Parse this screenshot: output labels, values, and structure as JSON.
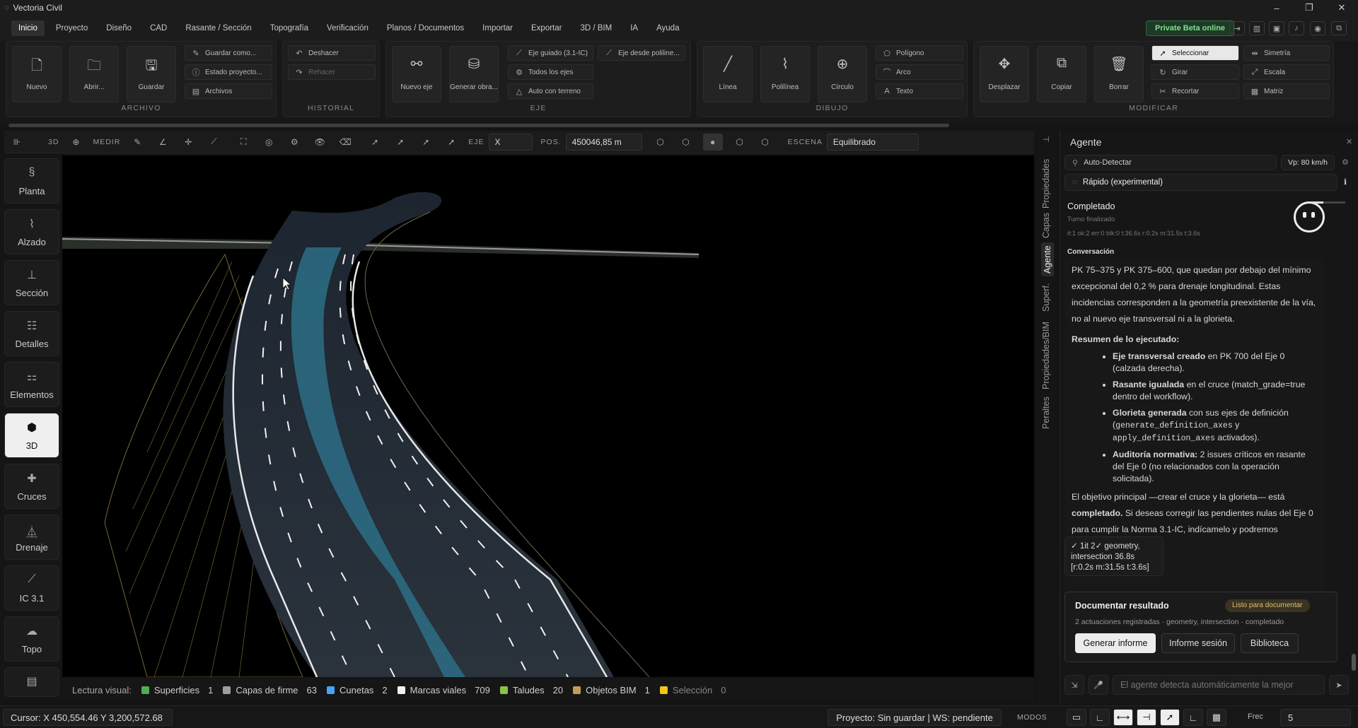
{
  "window": {
    "title": "Vectoria Civil",
    "controls": [
      "–",
      "❐",
      "✕"
    ]
  },
  "menu": {
    "items": [
      "Inicio",
      "Proyecto",
      "Diseño",
      "CAD",
      "Rasante / Sección",
      "Topografía",
      "Verificación",
      "Planos / Documentos",
      "Importar",
      "Exportar",
      "3D / BIM",
      "IA",
      "Ayuda"
    ],
    "active": "Inicio",
    "beta": "Private Beta online"
  },
  "ribbon": {
    "archivo": {
      "label": "ARCHIVO",
      "nuevo": "Nuevo",
      "abrir": "Abrir...",
      "guardar": "Guardar",
      "guardar_como": "Guardar como...",
      "estado": "Estado proyecto...",
      "archivos": "Archivos"
    },
    "historial": {
      "label": "HISTORIAL",
      "deshacer": "Deshacer",
      "rehacer": "Rehacer"
    },
    "eje": {
      "label": "EJE",
      "nuevo_eje": "Nuevo eje",
      "generar_obra": "Generar obra...",
      "eje_guiado": "Eje guiado (3.1-IC)",
      "eje_polilinea": "Eje desde poliline...",
      "todos_ejes": "Todos los ejes",
      "auto_terreno": "Auto con terreno"
    },
    "dibujo": {
      "label": "DIBUJO",
      "linea": "Línea",
      "polilinea": "Polilínea",
      "circulo": "Círculo",
      "poligono": "Polígono",
      "arco": "Arco",
      "texto": "Texto"
    },
    "modificar": {
      "label": "MODIFICAR",
      "desplazar": "Desplazar",
      "copiar": "Copiar",
      "borrar": "Borrar",
      "seleccionar": "Seleccionar",
      "simetria": "Simetría",
      "girar": "Girar",
      "escala": "Escala",
      "recortar": "Recortar",
      "matriz": "Matriz"
    }
  },
  "toolbar": {
    "mode": "3D",
    "medir": "MEDIR",
    "eje_label": "EJE",
    "eje_value": "X",
    "pos_label": "POS.",
    "pos_value": "450046,85 m",
    "escena_label": "ESCENA",
    "escena_value": "Equilibrado"
  },
  "leftnav": [
    "Planta",
    "Alzado",
    "Sección",
    "Detalles",
    "Elementos",
    "3D",
    "Cruces",
    "Drenaje",
    "IC 3.1",
    "Topo"
  ],
  "leftnav_active": "3D",
  "legend": {
    "title": "Lectura visual:",
    "items": [
      {
        "name": "Superficies",
        "count": "1",
        "color": "#4caf50"
      },
      {
        "name": "Capas de firme",
        "count": "63",
        "color": "#9e9e9e"
      },
      {
        "name": "Cunetas",
        "count": "2",
        "color": "#42a5f5"
      },
      {
        "name": "Marcas viales",
        "count": "709",
        "color": "#f2f2f2"
      },
      {
        "name": "Taludes",
        "count": "20",
        "color": "#8bc34a"
      },
      {
        "name": "Objetos BIM",
        "count": "1",
        "color": "#c49a5a"
      },
      {
        "name": "Selección",
        "count": "0",
        "color": "#f5c518"
      }
    ]
  },
  "status": {
    "cursor": "Cursor: X 450,554.46  Y 3,200,572.68",
    "proyecto": "Proyecto: Sin guardar | WS: pendiente",
    "modos": "MODOS",
    "frec_label": "Frec",
    "frec_value": "5"
  },
  "sidetabs": [
    "Propiedades",
    "Capas",
    "Agente",
    "Superf.",
    "Propiedades/BIM",
    "Peraltes"
  ],
  "agent": {
    "title": "Agente",
    "detect": "Auto-Detectar",
    "vp": "Vp: 80 km/h",
    "mode": "Rápido (experimental)",
    "status_title": "Completado",
    "status_sub": "Turno finalizado",
    "status_meta": "it:1 ok:2 err:0 blk:0 t:36.6s  r:0.2s m:31.5s t:3.6s",
    "conv_label": "Conversación",
    "intro": "PK 75–375 y PK 375–600, que quedan por debajo del mínimo excepcional del 0,2 % para drenaje longitudinal. Estas incidencias corresponden a la geometría preexistente de la vía, no al nuevo eje transversal ni a la glorieta.",
    "summary_title": "Resumen de lo ejecutado:",
    "b1_strong": "Eje transversal creado",
    "b1_rest": " en PK 700 del Eje 0 (calzada derecha).",
    "b2_strong": "Rasante igualada",
    "b2_rest": " en el cruce (match_grade=true dentro del workflow).",
    "b3_strong": "Glorieta generada",
    "b3_rest": " con sus ejes de definición (",
    "b3_code1": "generate_definition_axes",
    "b3_y": " y ",
    "b3_code2": "apply_definition_axes",
    "b3_end": " activados).",
    "b4_strong": "Auditoría normativa:",
    "b4_rest": " 2 issues críticos en rasante del Eje 0 (no relacionados con la operación solicitada).",
    "outro1": "El objetivo principal —crear el cruce y la glorieta— está ",
    "outro_strong": "completado.",
    "outro2": " Si deseas corregir las pendientes nulas del Eje 0 para cumplir la Norma 3.1-IC, indícamelo y podremos proceder.",
    "metrics": "✓ 1it 2✓ geometry, intersection 36.8s [r:0.2s m:31.5s t:3.6s]",
    "doc_title": "Documentar resultado",
    "doc_badge": "Listo para documentar",
    "doc_sub": "2 actuaciones registradas · geometry, intersection · completado",
    "btn_informe": "Generar informe",
    "btn_sesion": "Informe sesión",
    "btn_biblio": "Biblioteca",
    "input_placeholder": "El agente detecta automáticamente la mejor"
  }
}
